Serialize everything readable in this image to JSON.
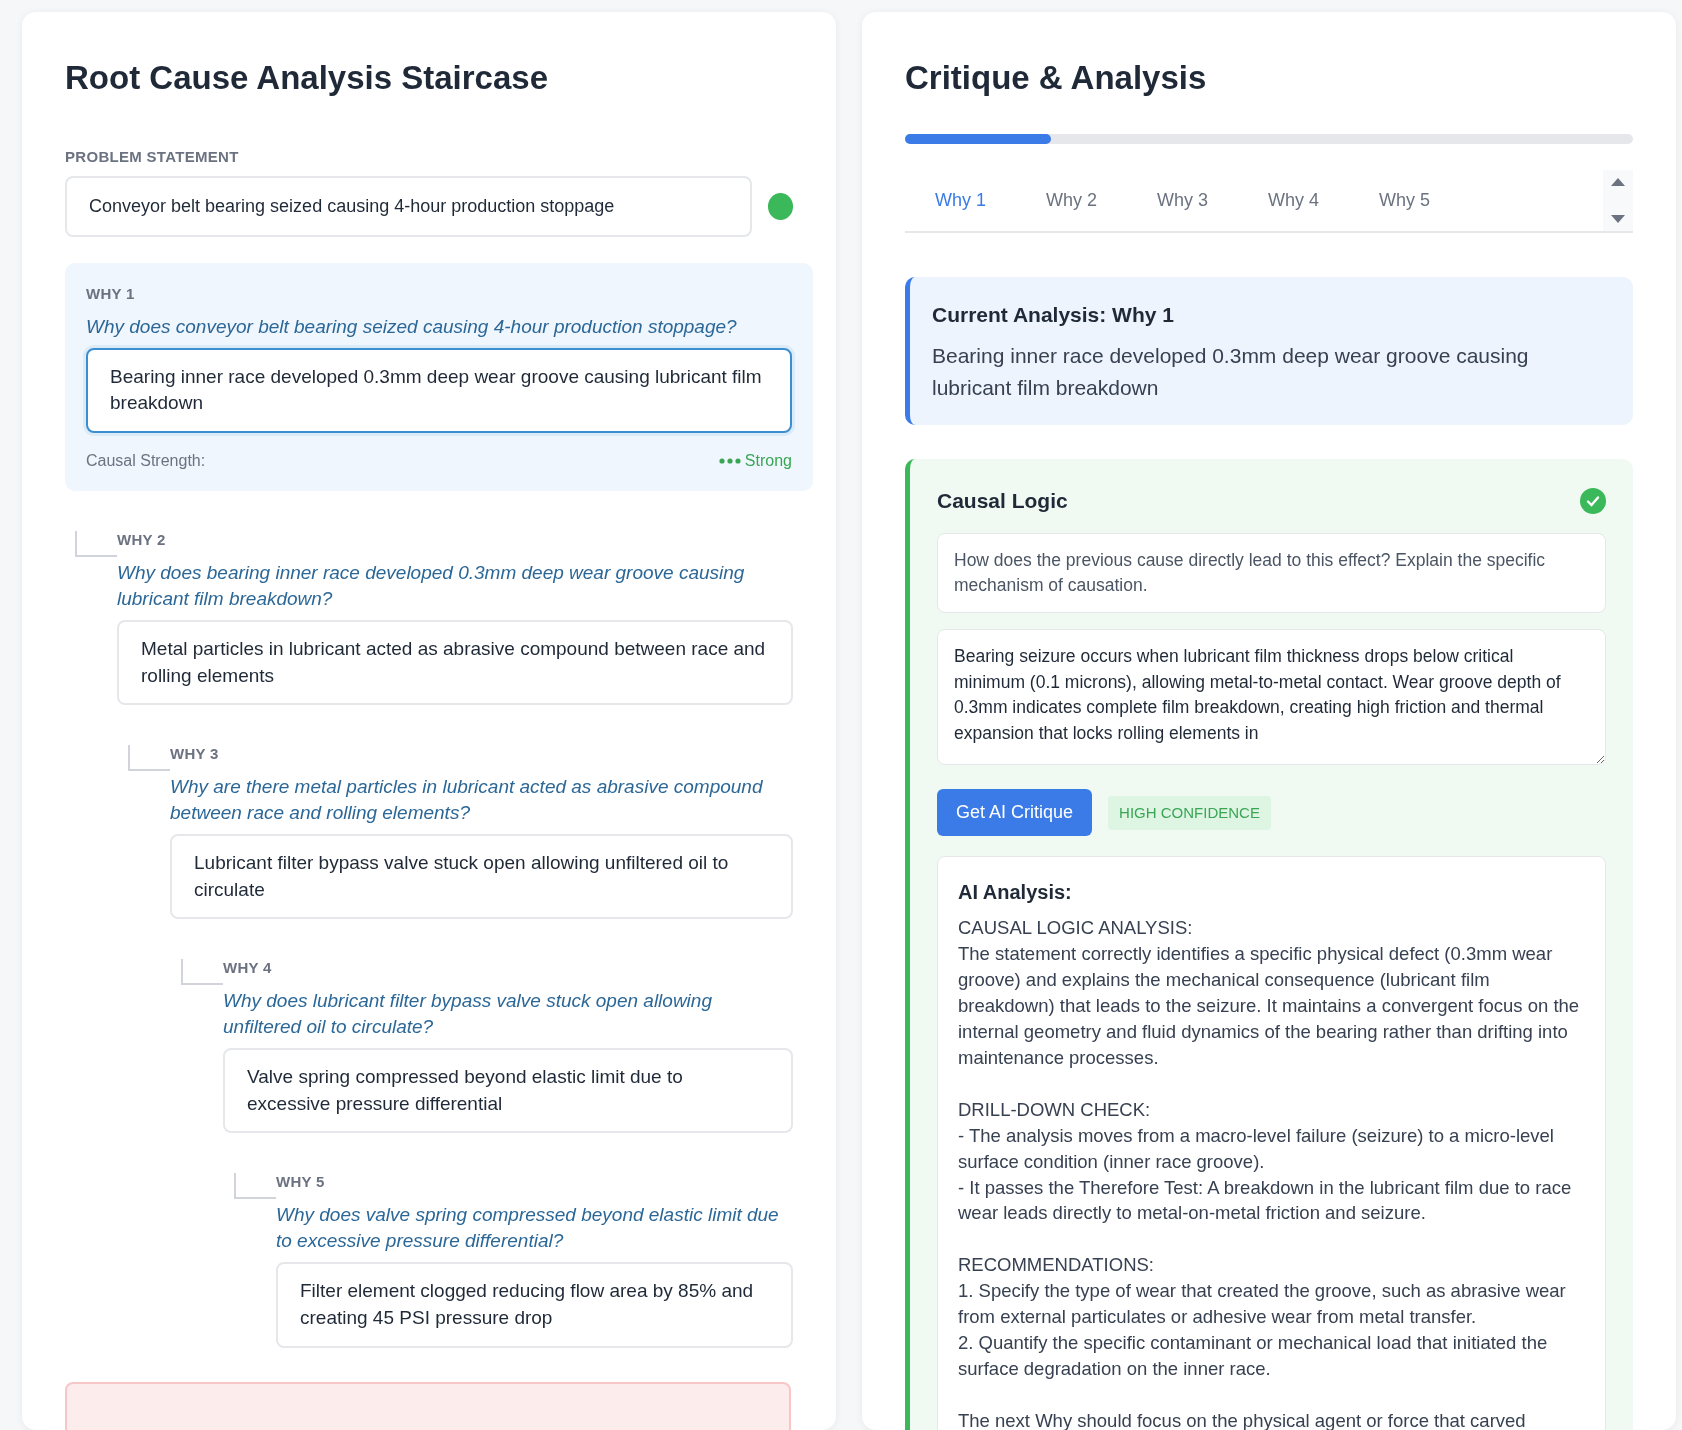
{
  "staircase": {
    "title": "Root Cause Analysis Staircase",
    "problem_label": "PROBLEM STATEMENT",
    "problem_value": "Conveyor belt bearing seized causing 4-hour production stoppage",
    "whys": [
      {
        "label": "WHY 1",
        "question": "Why does conveyor belt bearing seized causing 4-hour production stoppage?",
        "answer": "Bearing inner race developed 0.3mm deep wear groove causing lubricant film breakdown",
        "selected": true,
        "strength_label": "Causal Strength:",
        "strength": "Strong",
        "children": [
          {
            "label": "WHY 2",
            "question": "Why does bearing inner race developed 0.3mm deep wear groove causing lubricant film breakdown?",
            "answer": "Metal particles in lubricant acted as abrasive compound between race and rolling elements",
            "selected": false,
            "children": [
              {
                "label": "WHY 3",
                "question": "Why are there metal particles in lubricant acted as abrasive compound between race and rolling elements?",
                "answer": "Lubricant filter bypass valve stuck open allowing unfiltered oil to circulate",
                "selected": false,
                "children": [
                  {
                    "label": "WHY 4",
                    "question": "Why does lubricant filter bypass valve stuck open allowing unfiltered oil to circulate?",
                    "answer": "Valve spring compressed beyond elastic limit due to excessive pressure differential",
                    "selected": false,
                    "children": [
                      {
                        "label": "WHY 5",
                        "question": "Why does valve spring compressed beyond elastic limit due to excessive pressure differential?",
                        "answer": "Filter element clogged reducing flow area by 85% and creating 45 PSI pressure drop",
                        "selected": false
                      }
                    ]
                  }
                ]
              }
            ]
          }
        ]
      }
    ]
  },
  "critique": {
    "title": "Critique & Analysis",
    "progress": {
      "level": 0.2
    },
    "tabs": [
      {
        "label": "Why 1",
        "selected": true
      },
      {
        "label": "Why 2",
        "selected": false
      },
      {
        "label": "Why 3",
        "selected": false
      },
      {
        "label": "Why 4",
        "selected": false
      },
      {
        "label": "Why 5",
        "selected": false
      }
    ],
    "current": {
      "title": "Current Analysis: Why 1",
      "text": "Bearing inner race developed 0.3mm deep wear groove causing lubricant film breakdown"
    },
    "section": {
      "title": "Causal Logic",
      "checked": true,
      "prompt": "How does the previous cause directly lead to this effect? Explain the specific mechanism of causation.",
      "answer": "Bearing seizure occurs when lubricant film thickness drops below critical minimum (0.1 microns), allowing metal-to-metal contact. Wear groove depth of 0.3mm indicates complete film breakdown, creating high friction and thermal expansion that locks rolling elements in",
      "button": "Get AI Critique",
      "confidence": "HIGH CONFIDENCE",
      "ai_title": "AI Analysis:",
      "ai_paragraphs": [
        "CAUSAL LOGIC ANALYSIS:\nThe statement correctly identifies a specific physical defect (0.3mm wear groove) and explains the mechanical consequence (lubricant film breakdown) that leads to the seizure. It maintains a convergent focus on the internal geometry and fluid dynamics of the bearing rather than drifting into maintenance processes.",
        "DRILL-DOWN CHECK:\n- The analysis moves from a macro-level failure (seizure) to a micro-level surface condition (inner race groove).\n- It passes the Therefore Test: A breakdown in the lubricant film due to race wear leads directly to metal-on-metal friction and seizure.",
        "RECOMMENDATIONS:\n1. Specify the type of wear that created the groove, such as abrasive wear from external particulates or adhesive wear from metal transfer.\n2. Quantify the specific contaminant or mechanical load that initiated the surface degradation on the inner race.",
        "The next Why should focus on the physical agent or force that carved"
      ]
    }
  }
}
